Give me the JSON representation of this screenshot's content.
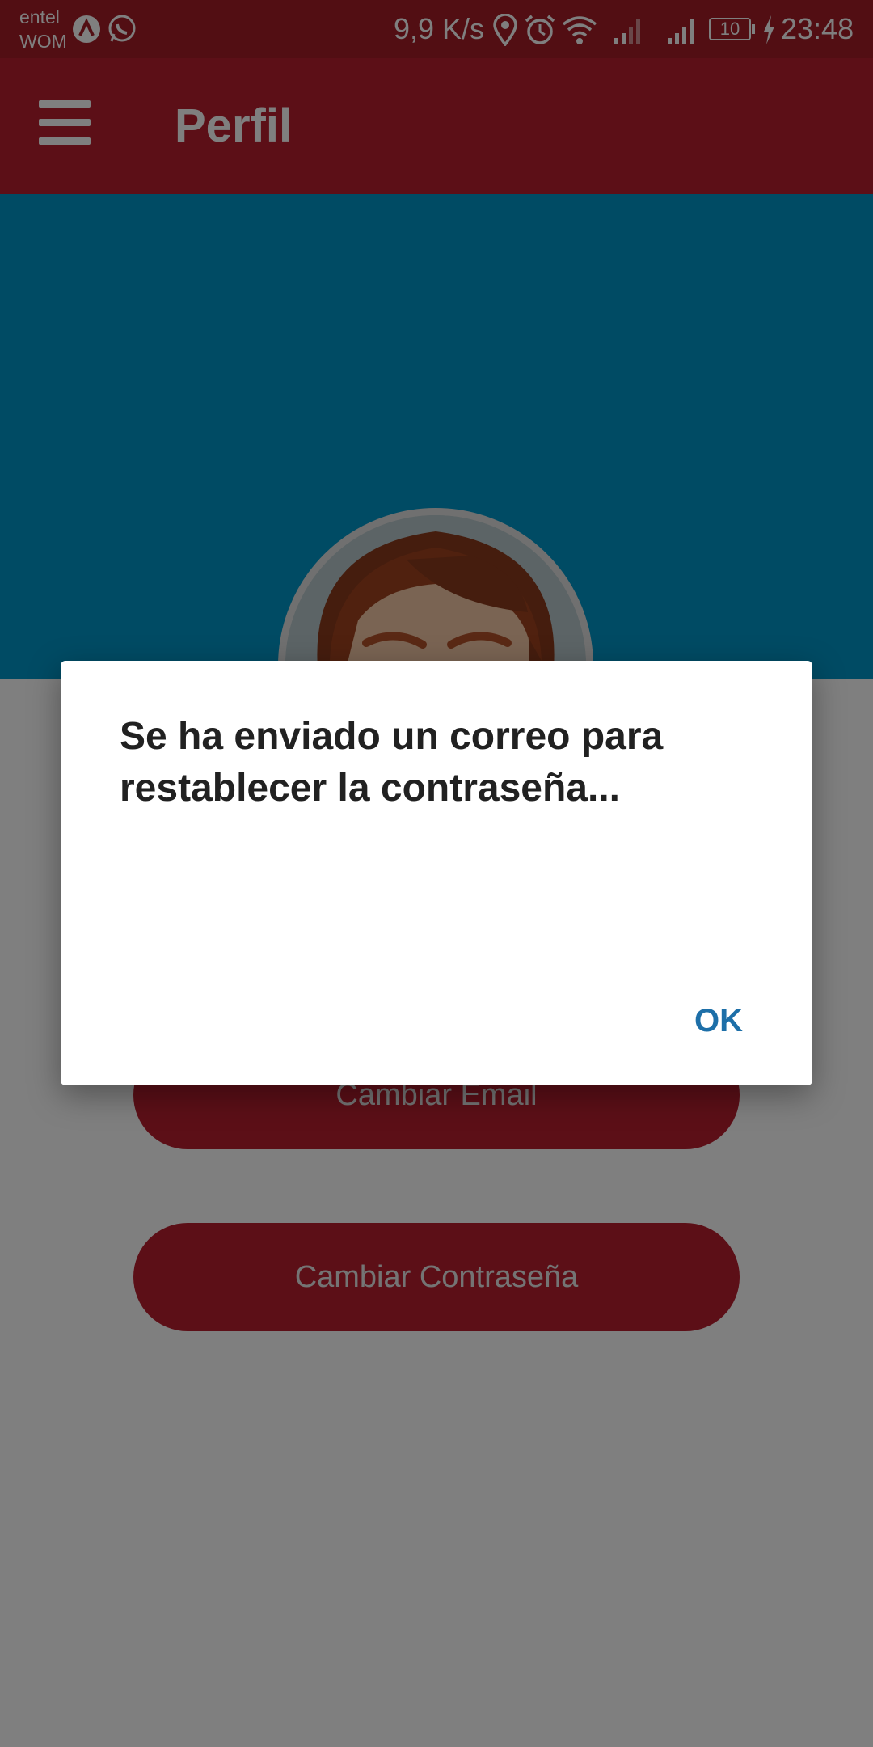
{
  "status_bar": {
    "carrier_1": "entel",
    "carrier_2": "WOM",
    "net_speed": "9,9 K/s",
    "battery": "10",
    "time": "23:48",
    "icons": [
      "app-notification-icon",
      "whatsapp-icon",
      "location-icon",
      "alarm-icon",
      "wifi-icon",
      "signal-icon",
      "signal-icon",
      "battery-icon",
      "charging-icon"
    ]
  },
  "app_bar": {
    "title": "Perfil",
    "menu_icon": "hamburger-menu-icon"
  },
  "profile": {
    "change_email_label": "Cambiar Email",
    "change_password_label": "Cambiar Contraseña"
  },
  "dialog": {
    "message": "Se ha enviado un correo para restablecer la contraseña...",
    "ok_label": "OK"
  },
  "colors": {
    "primary": "#b81e2e",
    "status_bar": "#a51c27",
    "banner": "#0097c9",
    "dialog_action": "#1d6fa8",
    "scrim": "#000000"
  }
}
